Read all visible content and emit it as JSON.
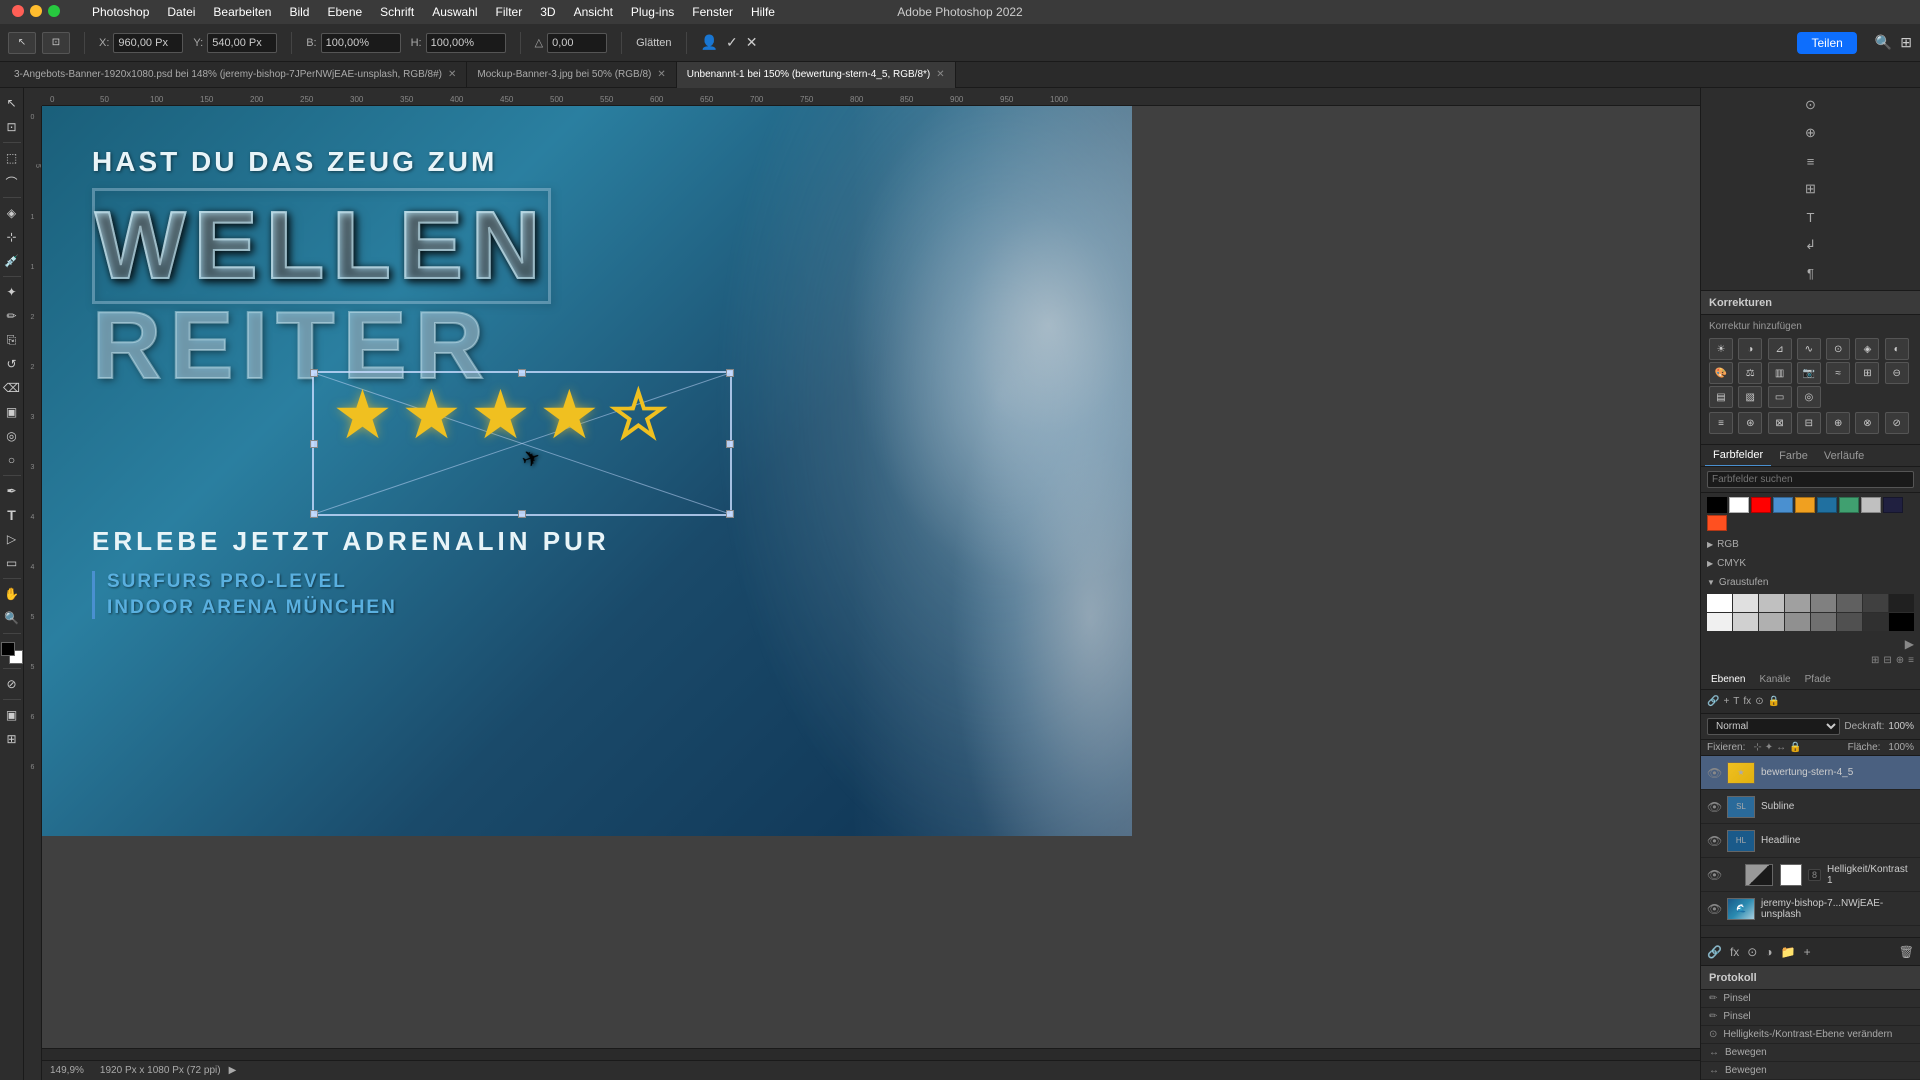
{
  "app": {
    "title": "Adobe Photoshop 2022",
    "mac_menu": [
      "Photoshop",
      "Datei",
      "Bearbeiten",
      "Bild",
      "Ebene",
      "Schrift",
      "Auswahl",
      "Filter",
      "3D",
      "Ansicht",
      "Plug-ins",
      "Fenster",
      "Hilfe"
    ]
  },
  "toolbar": {
    "x_label": "X:",
    "x_value": "960,00 Px",
    "y_label": "Y:",
    "y_value": "540,00 Px",
    "b_label": "B:",
    "b_value": "100,00%",
    "h_label": "H:",
    "h_value": "100,00%",
    "angle_value": "0,00",
    "glaetten": "Glätten",
    "share_label": "Teilen"
  },
  "tabs": [
    {
      "id": "tab1",
      "label": "3-Angebots-Banner-1920x1080.psd bei 148% (jeremy-bishop-7JPerNWjEAE-unsplash, RGB/8#)",
      "active": false
    },
    {
      "id": "tab2",
      "label": "Mockup-Banner-3.jpg bei 50% (RGB/8)",
      "active": false
    },
    {
      "id": "tab3",
      "label": "Unbenannt-1 bei 150% (bewertung-stern-4_5, RGB/8*)",
      "active": true
    }
  ],
  "canvas": {
    "zoom": "149,9%",
    "dimensions": "1920 Px x 1080 Px (72 ppi)"
  },
  "banner": {
    "headline": "HAST DU DAS ZEUG ZUM",
    "line1": "WELLEN",
    "line2": "REITER",
    "stars": [
      "filled",
      "filled",
      "filled",
      "filled",
      "empty"
    ],
    "bottom_title": "ERLEBE JETZT ADRENALIN PUR",
    "subtitle1": "SURFURS PRO-LEVEL",
    "subtitle2": "INDOOR ARENA MÜNCHEN"
  },
  "right_panel": {
    "korrekturen": {
      "panel_title": "Korrekturen",
      "add_label": "Korrektur hinzufügen"
    },
    "farb_tabs": [
      "Farbfelder",
      "Farbe",
      "Verläufe"
    ],
    "farb_tab_active": "Farbfelder",
    "farb_search_placeholder": "Farbfelder suchen",
    "color_groups": [
      {
        "name": "RGB",
        "expanded": false
      },
      {
        "name": "CMYK",
        "expanded": false
      },
      {
        "name": "Graustufen",
        "expanded": true
      }
    ],
    "swatches_top": [
      "#000000",
      "#ffffff",
      "#ff0000",
      "#00ff00",
      "#0000ff",
      "#ffff00",
      "#00ffff",
      "#ff00ff",
      "#808080",
      "#c0c0c0",
      "#4a90d0",
      "#e87820",
      "#2a8040",
      "#8040a0",
      "#d04040",
      "#204080"
    ],
    "graustufen": [
      "#ffffff",
      "#e0e0e0",
      "#c0c0c0",
      "#a0a0a0",
      "#808080",
      "#606060",
      "#404040",
      "#202020",
      "#f0f0f0",
      "#d0d0d0",
      "#b0b0b0",
      "#909090",
      "#707070",
      "#505050",
      "#303030",
      "#000000"
    ],
    "ebenen_tabs": [
      "Ebenen",
      "Kanäle",
      "Pfade"
    ],
    "ebenen_tab_active": "Ebenen",
    "layer_mode": "Normal",
    "layer_opacity": "100%",
    "layer_fill": "100%",
    "layers": [
      {
        "name": "bewertung-stern-4_5",
        "type": "group",
        "visible": true,
        "active": true
      },
      {
        "name": "Subline",
        "type": "group",
        "visible": true,
        "active": false
      },
      {
        "name": "Headline",
        "type": "group",
        "visible": true,
        "active": false
      },
      {
        "name": "Helligkeit/Kontrast 1",
        "type": "adjustment",
        "visible": true,
        "active": false,
        "badge": "8"
      },
      {
        "name": "jeremy-bishop-7...NWjEAE-unsplash",
        "type": "image",
        "visible": true,
        "active": false
      }
    ],
    "protokoll_title": "Protokoll",
    "protokoll_items": [
      "Pinsel",
      "Pinsel",
      "Helligkeits-/Kontrast-Ebene verändern",
      "Bewegen",
      "Bewegen"
    ]
  }
}
